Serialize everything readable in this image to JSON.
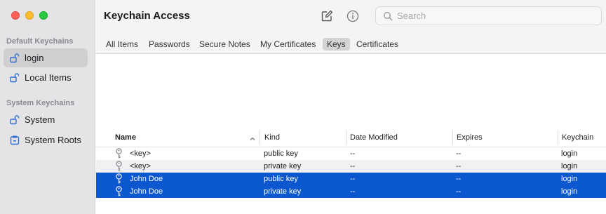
{
  "window": {
    "title": "Keychain Access"
  },
  "toolbar": {
    "edit_icon": "compose-icon",
    "info_icon": "info-icon",
    "search_placeholder": "Search"
  },
  "sidebar": {
    "sections": [
      {
        "label": "Default Keychains",
        "items": [
          {
            "label": "login",
            "icon": "open-lock-icon",
            "selected": true
          },
          {
            "label": "Local Items",
            "icon": "open-lock-icon",
            "selected": false
          }
        ]
      },
      {
        "label": "System Keychains",
        "items": [
          {
            "label": "System",
            "icon": "open-lock-icon",
            "selected": false
          },
          {
            "label": "System Roots",
            "icon": "cabinet-icon",
            "selected": false
          }
        ]
      }
    ]
  },
  "tabs": [
    {
      "label": "All Items",
      "active": false
    },
    {
      "label": "Passwords",
      "active": false
    },
    {
      "label": "Secure Notes",
      "active": false
    },
    {
      "label": "My Certificates",
      "active": false
    },
    {
      "label": "Keys",
      "active": true
    },
    {
      "label": "Certificates",
      "active": false
    }
  ],
  "table": {
    "columns": [
      "Name",
      "Kind",
      "Date Modified",
      "Expires",
      "Keychain"
    ],
    "sort_column": "Name",
    "rows": [
      {
        "name": "<key>",
        "kind": "public key",
        "date_modified": "--",
        "expires": "--",
        "keychain": "login",
        "selected": false
      },
      {
        "name": "<key>",
        "kind": "private key",
        "date_modified": "--",
        "expires": "--",
        "keychain": "login",
        "selected": false
      },
      {
        "name": "John Doe",
        "kind": "public key",
        "date_modified": "--",
        "expires": "--",
        "keychain": "login",
        "selected": true
      },
      {
        "name": "John Doe",
        "kind": "private key",
        "date_modified": "--",
        "expires": "--",
        "keychain": "login",
        "selected": true
      }
    ]
  },
  "colors": {
    "selection": "#0b57d0",
    "sidebar_bg": "#e4e4e6",
    "icon_blue": "#2f6fd6"
  }
}
